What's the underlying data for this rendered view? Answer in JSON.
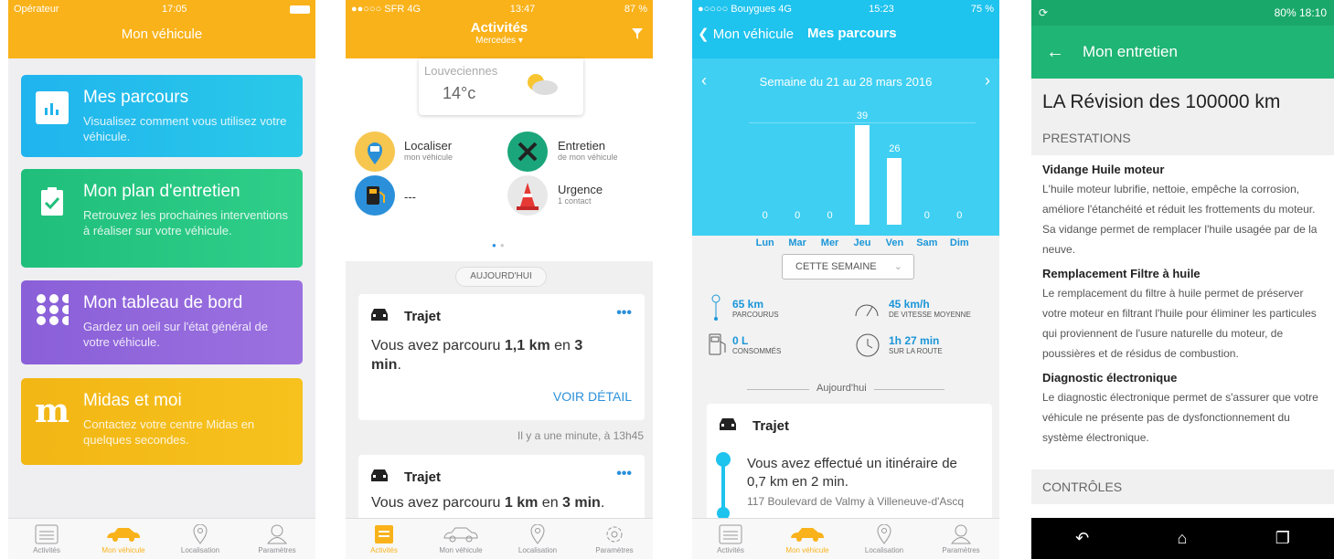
{
  "p1": {
    "carrier": "Opérateur",
    "time": "17:05",
    "title": "Mon véhicule",
    "cards": [
      {
        "title": "Mes parcours",
        "sub": "Visualisez comment vous utilisez votre véhicule."
      },
      {
        "title": "Mon plan d'entretien",
        "sub": "Retrouvez les prochaines interventions à réaliser sur votre véhicule."
      },
      {
        "title": "Mon tableau de bord",
        "sub": "Gardez un oeil sur l'état général de votre véhicule."
      },
      {
        "title": "Midas et moi",
        "sub": "Contactez votre centre Midas en quelques secondes."
      }
    ],
    "tabs": [
      "Activités",
      "Mon véhicule",
      "Localisation",
      "Paramètres"
    ]
  },
  "p2": {
    "carrier": "●●○○○ SFR  4G",
    "time": "13:47",
    "battery": "87 %",
    "title": "Activités",
    "subtitle": "Mercedes ▾",
    "weather_city": "Louveciennes",
    "weather_temp": "14°c",
    "actions": [
      {
        "t": "Localiser",
        "s": "mon véhicule"
      },
      {
        "t": "Entretien",
        "s": "de mon véhicule"
      },
      {
        "t": "---",
        "s": ""
      },
      {
        "t": "Urgence",
        "s": "1 contact"
      }
    ],
    "today": "AUJOURD'HUI",
    "trip1": {
      "title": "Trajet",
      "pre": "Vous avez parcouru ",
      "dist": "1,1 km",
      "mid": " en ",
      "dur": "3 min",
      "end": ".",
      "link": "VOIR DÉTAIL",
      "ts": "Il y a une minute, à 13h45"
    },
    "trip2": {
      "title": "Trajet",
      "pre": "Vous avez parcouru ",
      "dist": "1 km",
      "mid": " en ",
      "dur": "3 min",
      "end": "."
    },
    "tabs": [
      "Activités",
      "Mon véhicule",
      "Localisation",
      "Paramètres"
    ]
  },
  "p3": {
    "carrier": "●○○○○ Bouygues  4G",
    "time": "15:23",
    "battery": "75 %",
    "back": "Mon véhicule",
    "title": "Mes parcours",
    "week": "Semaine du 21 au 28 mars 2016",
    "chart_data": {
      "type": "bar",
      "categories": [
        "Lun",
        "Mar",
        "Mer",
        "Jeu",
        "Ven",
        "Sam",
        "Dim"
      ],
      "values": [
        0,
        0,
        0,
        39,
        26,
        0,
        0
      ],
      "ylim": [
        0,
        40
      ]
    },
    "selector": "CETTE SEMAINE",
    "stats": [
      {
        "v": "65 km",
        "l": "PARCOURUS"
      },
      {
        "v": "45 km/h",
        "l": "DE VITESSE MOYENNE"
      },
      {
        "v": "0 L",
        "l": "CONSOMMÉS"
      },
      {
        "v": "1h 27 min",
        "l": "SUR LA ROUTE"
      }
    ],
    "today": "Aujourd'hui",
    "trip": {
      "title": "Trajet",
      "text": "Vous avez effectué un itinéraire de 0,7 km en 2 min.",
      "addr": "117 Boulevard de Valmy à Villeneuve-d'Ascq"
    },
    "tabs": [
      "Activités",
      "Mon véhicule",
      "Localisation",
      "Paramètres"
    ]
  },
  "p4": {
    "battery": "80%",
    "time": "18:10",
    "title": "Mon entretien",
    "heading": "LA Révision des 100000 km",
    "sec1": "PRESTATIONS",
    "items": [
      {
        "t": "Vidange Huile moteur",
        "d": "L'huile moteur lubrifie, nettoie, empêche la corrosion, améliore l'étanchéité et réduit les frottements du moteur. Sa vidange permet de remplacer l'huile usagée par de la neuve."
      },
      {
        "t": "Remplacement Filtre à huile",
        "d": "Le remplacement du filtre à huile permet de préserver votre moteur en filtrant l'huile pour éliminer les particules qui proviennent de l'usure naturelle du moteur, de poussières et de résidus de combustion."
      },
      {
        "t": "Diagnostic électronique",
        "d": "Le diagnostic électronique permet de s'assurer que votre véhicule ne présente pas de dysfonctionnement du système électronique."
      }
    ],
    "sec2": "CONTRÔLES"
  }
}
